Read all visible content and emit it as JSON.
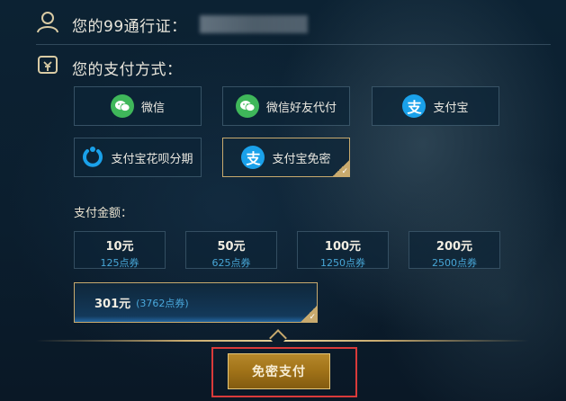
{
  "account": {
    "label": "您的99通行证："
  },
  "payment": {
    "label": "您的支付方式：",
    "methods": [
      {
        "label": "微信",
        "icon": "wechat-icon"
      },
      {
        "label": "微信好友代付",
        "icon": "wechat-icon"
      },
      {
        "label": "支付宝",
        "icon": "alipay-icon"
      },
      {
        "label": "支付宝花呗分期",
        "icon": "huabei-icon"
      },
      {
        "label": "支付宝免密",
        "icon": "alipay-icon",
        "selected": true
      }
    ]
  },
  "amount": {
    "label": "支付金额：",
    "options": [
      {
        "value": "10元",
        "points": "125点券"
      },
      {
        "value": "50元",
        "points": "625点券"
      },
      {
        "value": "100元",
        "points": "1250点券"
      },
      {
        "value": "200元",
        "points": "2500点券"
      }
    ],
    "selected": {
      "value": "301元",
      "points": "(3762点券)"
    }
  },
  "submit": {
    "label": "免密支付"
  },
  "colors": {
    "gold": "#c8aa6e",
    "wechat": "#3fb75a",
    "alipay": "#1aa1ea",
    "points": "#48a6d6",
    "highlight_box": "#d93a3a"
  }
}
